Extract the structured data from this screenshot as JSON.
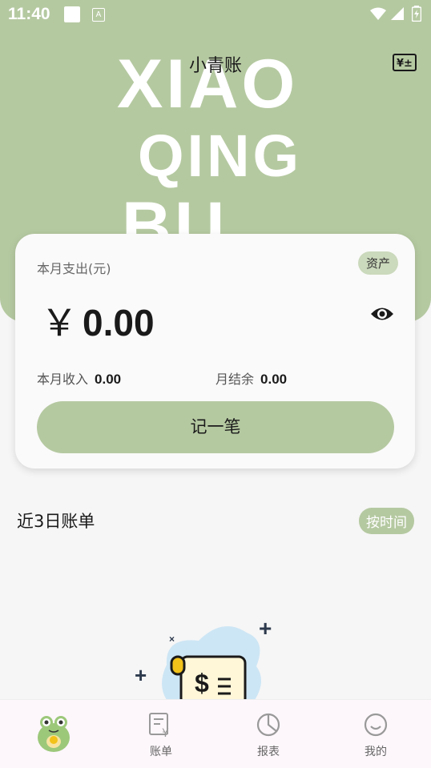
{
  "status_bar": {
    "time": "11:40",
    "a_badge": "A"
  },
  "header": {
    "title": "小青账",
    "watermark": [
      "XIAO",
      "QING",
      "BU"
    ],
    "calc_icon_text": "¥±"
  },
  "summary_card": {
    "label": "本月支出(元)",
    "asset_badge": "资产",
    "currency": "￥",
    "amount": "0.00",
    "income_label": "本月收入",
    "income_value": "0.00",
    "balance_label": "月结余",
    "balance_value": "0.00",
    "record_button": "记一笔"
  },
  "recent": {
    "title": "近3日账单",
    "sort_button": "按时间"
  },
  "bottom_nav": {
    "items": [
      {
        "label": "",
        "icon": "frog-mascot-icon"
      },
      {
        "label": "账单",
        "icon": "bill-icon"
      },
      {
        "label": "报表",
        "icon": "pie-chart-icon"
      },
      {
        "label": "我的",
        "icon": "smile-icon"
      }
    ]
  },
  "colors": {
    "accent": "#b5c9a1",
    "badge": "#cbd9bc",
    "background": "#f6f6f6"
  }
}
